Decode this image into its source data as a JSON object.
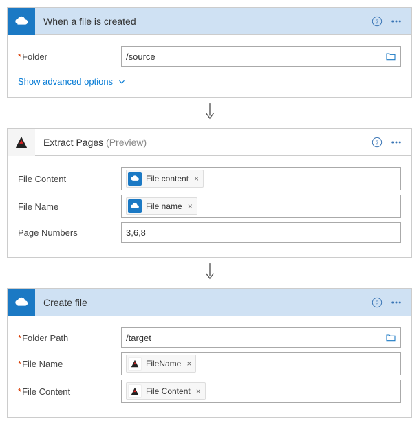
{
  "card1": {
    "title": "When a file is created",
    "fields": {
      "folder_label": "Folder",
      "folder_value": "/source"
    },
    "show_adv": "Show advanced options"
  },
  "card2": {
    "title": "Extract Pages",
    "preview": "(Preview)",
    "fields": {
      "file_content_label": "File Content",
      "file_content_token": "File content",
      "file_name_label": "File Name",
      "file_name_token": "File name",
      "page_numbers_label": "Page Numbers",
      "page_numbers_value": "3,6,8"
    }
  },
  "card3": {
    "title": "Create file",
    "fields": {
      "folder_path_label": "Folder Path",
      "folder_path_value": "/target",
      "file_name_label": "File Name",
      "file_name_token": "FileName",
      "file_content_label": "File Content",
      "file_content_token": "File Content"
    }
  }
}
